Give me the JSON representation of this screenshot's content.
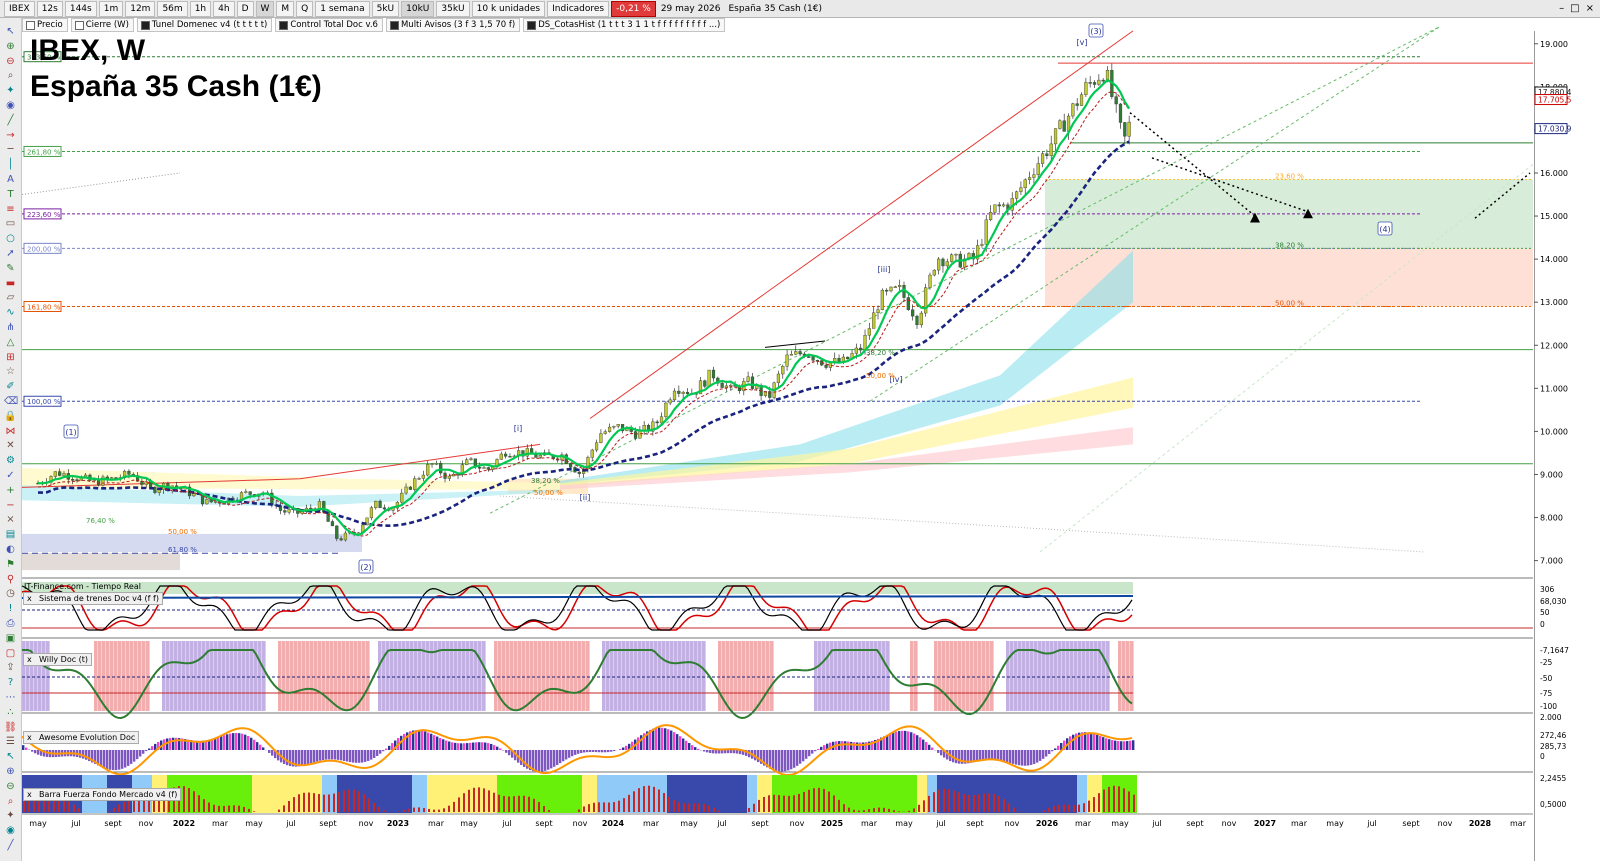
{
  "toolbar": {
    "symbol": "IBEX",
    "intervals": [
      "12s",
      "144s",
      "1m",
      "12m",
      "56m",
      "1h",
      "4h",
      "D",
      "W",
      "M",
      "Q"
    ],
    "active_interval": "W",
    "period": "1 semana",
    "units": [
      "5kU",
      "10kU",
      "35kU"
    ],
    "active_unit": "10kU",
    "unit_select": "10 k unidades",
    "indicators_label": "Indicadores",
    "change": "-0,21 %",
    "date": "29 may 2026",
    "instrument": "España 35 Cash (1€)"
  },
  "indicator_tabs": [
    "Precio",
    "Cierre (W)",
    "Tunel Domenec v4 (t t t t t)",
    "Control Total Doc v.6",
    "Multi Avisos (3 f 3 1,5 70 f)",
    "DS_CotasHist (1 t t t 3 1 1 t f f f f f f f f f ...)"
  ],
  "chart_title": {
    "line1": "IBEX, W",
    "line2": "España 35 Cash (1€)"
  },
  "source": "IT-Finance.com - Tiempo Real",
  "panels": [
    {
      "name": "Sistema de trenes Doc v4 (f f)",
      "axis": [
        "306",
        "68,030",
        "50",
        "0"
      ]
    },
    {
      "name": "Willy Doc (t)",
      "axis": [
        "-7,1647",
        "-25",
        "-50",
        "-75",
        "-100"
      ]
    },
    {
      "name": "Awesome Evolution Doc",
      "axis": [
        "2.000",
        "272,46",
        "285,73",
        "0"
      ]
    },
    {
      "name": "Barra Fuerza Fondo Mercado v4 (f)",
      "axis": [
        "2,2455",
        "0,5000"
      ]
    }
  ],
  "chart_data": {
    "type": "line",
    "title": "IBEX, W",
    "subtitle": "España 35 Cash (1€)",
    "y_ticks": [
      19000,
      18000,
      17000,
      16000,
      15000,
      14000,
      13000,
      12000,
      11000,
      10000,
      9000,
      8000,
      7000
    ],
    "y_tick_labels": [
      "19.000",
      "18.000",
      "17.000",
      "16.000",
      "15.000",
      "14.000",
      "13.000",
      "12.000",
      "11.000",
      "10.000",
      "9.000",
      "8.000",
      "7.000"
    ],
    "ylim": [
      6500,
      19600
    ],
    "price_tags": [
      {
        "value": 17880,
        "label": "17.880,4",
        "color": "#1a1a1a"
      },
      {
        "value": 17705,
        "label": "17.705,5",
        "color": "#cc0000"
      },
      {
        "value": 17030,
        "label": "17.030,9",
        "color": "#1a237e"
      }
    ],
    "x_labels": [
      "may",
      "jul",
      "sept",
      "nov",
      "2022",
      "mar",
      "may",
      "jul",
      "sept",
      "nov",
      "2023",
      "mar",
      "may",
      "jul",
      "sept",
      "nov",
      "2024",
      "mar",
      "may",
      "jul",
      "sept",
      "nov",
      "2025",
      "mar",
      "may",
      "jul",
      "sept",
      "nov",
      "2026",
      "mar",
      "may",
      "jul",
      "sept",
      "nov",
      "2027",
      "mar",
      "may",
      "jul",
      "sept",
      "nov",
      "2028",
      "mar"
    ],
    "x_label_pos": [
      38,
      76,
      113,
      146,
      184,
      220,
      254,
      291,
      328,
      366,
      398,
      436,
      469,
      507,
      544,
      580,
      613,
      651,
      689,
      722,
      760,
      797,
      832,
      869,
      904,
      941,
      975,
      1012,
      1047,
      1083,
      1120,
      1157,
      1195,
      1229,
      1265,
      1299,
      1335,
      1372,
      1411,
      1445,
      1480,
      1518
    ],
    "close_series": [
      [
        "2021-05",
        8800
      ],
      [
        "2021-06",
        9050
      ],
      [
        "2021-07",
        8950
      ],
      [
        "2021-08",
        8820
      ],
      [
        "2021-09",
        8900
      ],
      [
        "2021-10",
        9020
      ],
      [
        "2021-11",
        8650
      ],
      [
        "2021-12",
        8780
      ],
      [
        "2022-01",
        8600
      ],
      [
        "2022-02",
        8350
      ],
      [
        "2022-03",
        8400
      ],
      [
        "2022-04",
        8550
      ],
      [
        "2022-05",
        8600
      ],
      [
        "2022-06",
        8150
      ],
      [
        "2022-07",
        8100
      ],
      [
        "2022-08",
        8300
      ],
      [
        "2022-09",
        7500
      ],
      [
        "2022-10",
        7650
      ],
      [
        "2022-11",
        8300
      ],
      [
        "2022-12",
        8250
      ],
      [
        "2023-01",
        8800
      ],
      [
        "2023-02",
        9250
      ],
      [
        "2023-03",
        8900
      ],
      [
        "2023-04",
        9300
      ],
      [
        "2023-05",
        9100
      ],
      [
        "2023-06",
        9550
      ],
      [
        "2023-07",
        9500
      ],
      [
        "2023-08",
        9400
      ],
      [
        "2023-09",
        9450
      ],
      [
        "2023-10",
        9000
      ],
      [
        "2023-11",
        9950
      ],
      [
        "2023-12",
        10100
      ],
      [
        "2024-01",
        9950
      ],
      [
        "2024-02",
        10150
      ],
      [
        "2024-03",
        11050
      ],
      [
        "2024-04",
        10900
      ],
      [
        "2024-05",
        11350
      ],
      [
        "2024-06",
        10950
      ],
      [
        "2024-07",
        11150
      ],
      [
        "2024-08",
        10750
      ],
      [
        "2024-09",
        11700
      ],
      [
        "2024-10",
        11850
      ],
      [
        "2024-11",
        11600
      ],
      [
        "2024-12",
        11600
      ],
      [
        "2025-01",
        11950
      ],
      [
        "2025-02",
        13100
      ],
      [
        "2025-03",
        13300
      ],
      [
        "2025-04",
        12600
      ],
      [
        "2025-05",
        14050
      ],
      [
        "2025-06",
        13950
      ],
      [
        "2025-07",
        14000
      ],
      [
        "2025-08",
        15150
      ],
      [
        "2025-09",
        15300
      ],
      [
        "2025-10",
        16000
      ],
      [
        "2025-11",
        16600
      ],
      [
        "2025-12",
        17300
      ],
      [
        "2026-01",
        18000
      ],
      [
        "2026-02",
        18400
      ],
      [
        "2026-03",
        16700
      ],
      [
        "2026-04",
        18100
      ],
      [
        "2026-05",
        17880
      ]
    ],
    "fib_levels": [
      {
        "label": "323,60 %",
        "value": 18700,
        "color": "#2e7d32"
      },
      {
        "label": "261,80 %",
        "value": 16500,
        "color": "#43a047"
      },
      {
        "label": "223,60 %",
        "value": 15050,
        "color": "#7b1fa2"
      },
      {
        "label": "200,00 %",
        "value": 14250,
        "color": "#7986cb"
      },
      {
        "label": "161,80 %",
        "value": 12900,
        "color": "#e65100"
      },
      {
        "label": "100,00 %",
        "value": 10700,
        "color": "#3949ab"
      }
    ],
    "retracements": [
      {
        "label": "23,60 %",
        "value": 15850
      },
      {
        "label": "38,20 %",
        "value": 14250
      },
      {
        "label": "50,00 %",
        "value": 12900
      }
    ],
    "wave_labels": [
      "(1)",
      "(2)",
      "(3)",
      "(4)",
      "[i]",
      "[ii]",
      "[iii]",
      "[iv]",
      "[v]"
    ],
    "minor_labels": [
      "76,40 %",
      "50,00 %",
      "61,80 %",
      "38,20 %",
      "50,00 %",
      "38,20 %",
      "50,00 %"
    ]
  }
}
